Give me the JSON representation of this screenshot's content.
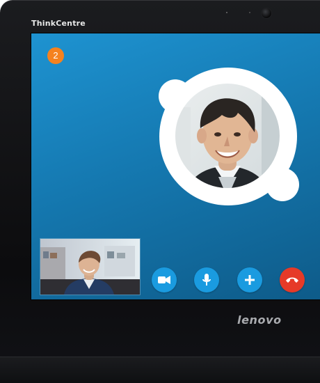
{
  "device": {
    "top_brand": "ThinkCentre",
    "bottom_brand": "lenovo"
  },
  "call": {
    "notification_count": "2",
    "controls": {
      "video_icon": "video-camera-icon",
      "mic_icon": "microphone-icon",
      "add_icon": "plus-icon",
      "end_icon": "phone-hangup-icon"
    }
  },
  "colors": {
    "screen_blue": "#1579b1",
    "badge_orange": "#f5821f",
    "control_blue": "#1a9be0",
    "end_call_red": "#e63a28"
  }
}
